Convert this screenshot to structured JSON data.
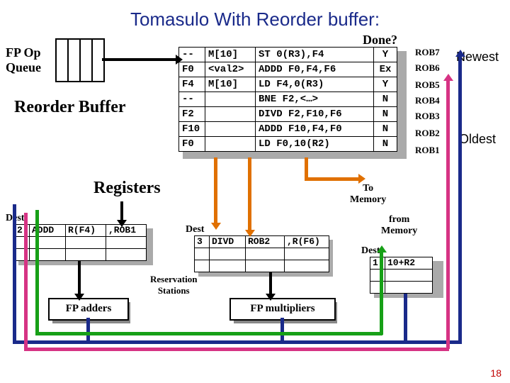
{
  "title": "Tomasulo With Reorder buffer:",
  "fpop_label": "FP Op\nQueue",
  "reorder_buffer_label": "Reorder Buffer",
  "done_label": "Done?",
  "rob": [
    {
      "dest": "--",
      "val": "M[10]",
      "instr": "ST 0(R3),F4",
      "done": "Y",
      "tag": "ROB7"
    },
    {
      "dest": "F0",
      "val": "<val2>",
      "instr": "ADDD F0,F4,F6",
      "done": "Ex",
      "tag": "ROB6"
    },
    {
      "dest": "F4",
      "val": "M[10]",
      "instr": "LD F4,0(R3)",
      "done": "Y",
      "tag": "ROB5"
    },
    {
      "dest": "--",
      "val": "",
      "instr": "BNE F2,<…>",
      "done": "N",
      "tag": "ROB4"
    },
    {
      "dest": "F2",
      "val": "",
      "instr": "DIVD F2,F10,F6",
      "done": "N",
      "tag": "ROB3"
    },
    {
      "dest": "F10",
      "val": "",
      "instr": "ADDD F10,F4,F0",
      "done": "N",
      "tag": "ROB2"
    },
    {
      "dest": "F0",
      "val": "",
      "instr": "LD F0,10(R2)",
      "done": "N",
      "tag": "ROB1"
    }
  ],
  "newest_label": "Newest",
  "oldest_label": "Oldest",
  "registers_label": "Registers",
  "to_memory_label": "To\nMemory",
  "from_memory_label": "from\nMemory",
  "dest_label": "Dest",
  "rs_left": {
    "tag": "2",
    "op": "ADDD",
    "a": "R(F4)",
    "b": ",ROB1"
  },
  "rs_mid": {
    "tag": "3",
    "op": "DIVD",
    "a": "ROB2",
    "b": ",R(F6)"
  },
  "rs_right": {
    "tag": "1",
    "val": "10+R2"
  },
  "resv_stations_label": "Reservation\nStations",
  "fp_adders_label": "FP adders",
  "fp_mult_label": "FP multipliers",
  "page_num": "18"
}
